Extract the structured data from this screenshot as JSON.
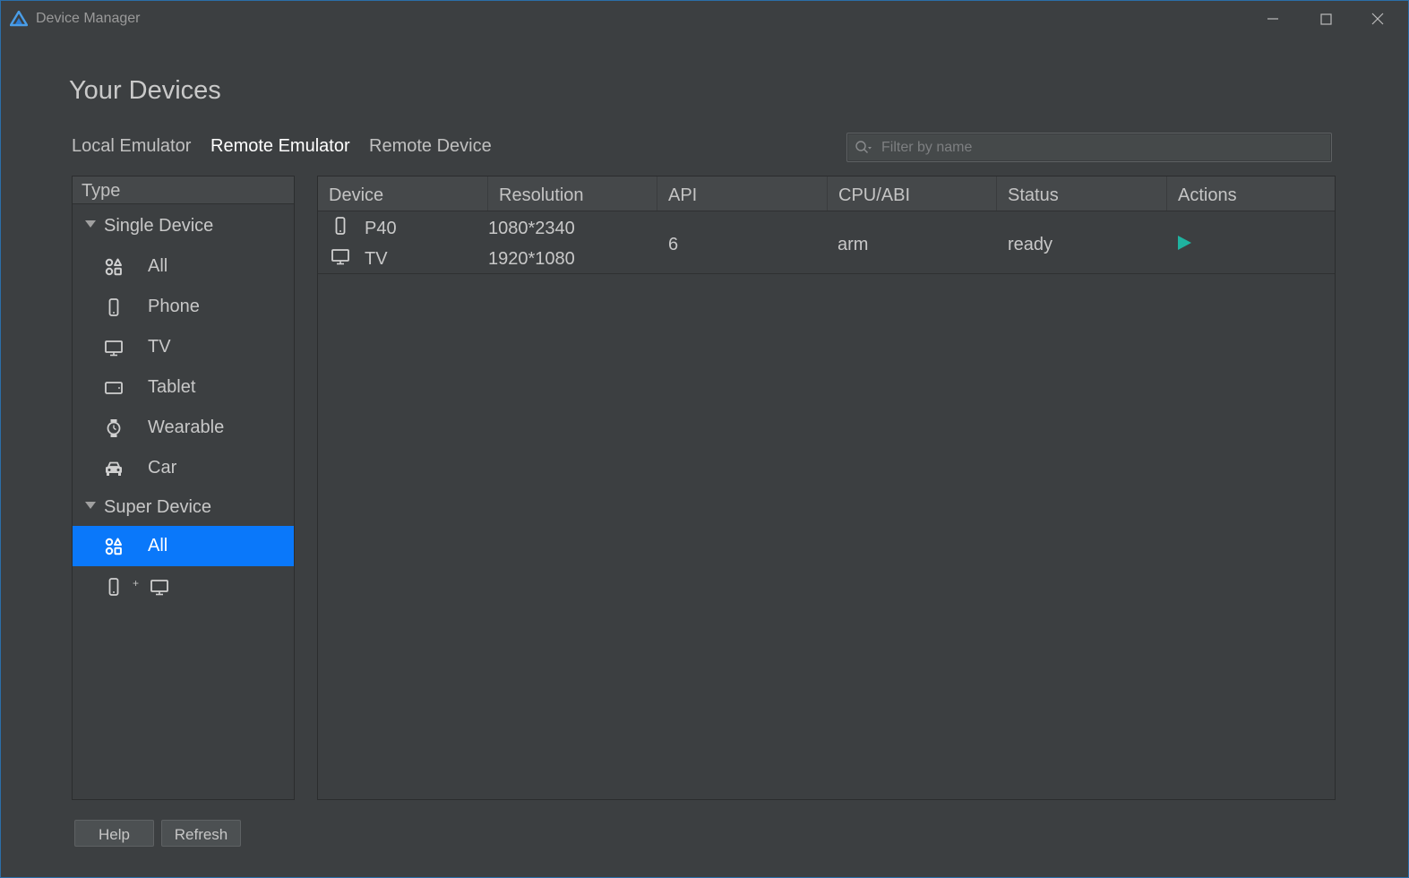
{
  "window": {
    "title": "Device Manager"
  },
  "page": {
    "title": "Your Devices"
  },
  "tabs": [
    {
      "label": "Local Emulator",
      "active": false
    },
    {
      "label": "Remote Emulator",
      "active": true
    },
    {
      "label": "Remote Device",
      "active": false
    }
  ],
  "search": {
    "placeholder": "Filter by name",
    "value": ""
  },
  "sidebar": {
    "header": "Type",
    "groups": [
      {
        "label": "Single Device",
        "items": [
          {
            "label": "All",
            "icon": "apps-icon"
          },
          {
            "label": "Phone",
            "icon": "phone-icon"
          },
          {
            "label": "TV",
            "icon": "tv-icon"
          },
          {
            "label": "Tablet",
            "icon": "tablet-icon"
          },
          {
            "label": "Wearable",
            "icon": "watch-icon"
          },
          {
            "label": "Car",
            "icon": "car-icon"
          }
        ]
      },
      {
        "label": "Super Device",
        "items": [
          {
            "label": "All",
            "icon": "apps-icon",
            "selected": true
          },
          {
            "label": "",
            "icon": "phone-plus-tv-icon",
            "plus": "+"
          }
        ]
      }
    ]
  },
  "table": {
    "columns": [
      "Device",
      "Resolution",
      "API",
      "CPU/ABI",
      "Status",
      "Actions"
    ],
    "rows": [
      {
        "devices": [
          {
            "name": "P40",
            "icon": "phone-icon",
            "resolution": "1080*2340"
          },
          {
            "name": "TV",
            "icon": "tv-icon",
            "resolution": "1920*1080"
          }
        ],
        "api": "6",
        "cpu_abi": "arm",
        "status": "ready",
        "action_icon": "play-icon"
      }
    ]
  },
  "buttons": {
    "help": "Help",
    "refresh": "Refresh"
  },
  "colors": {
    "background": "#3c3f41",
    "selection": "#0a78fa",
    "play": "#1fb3a0",
    "window_border": "#2b6ea8"
  }
}
